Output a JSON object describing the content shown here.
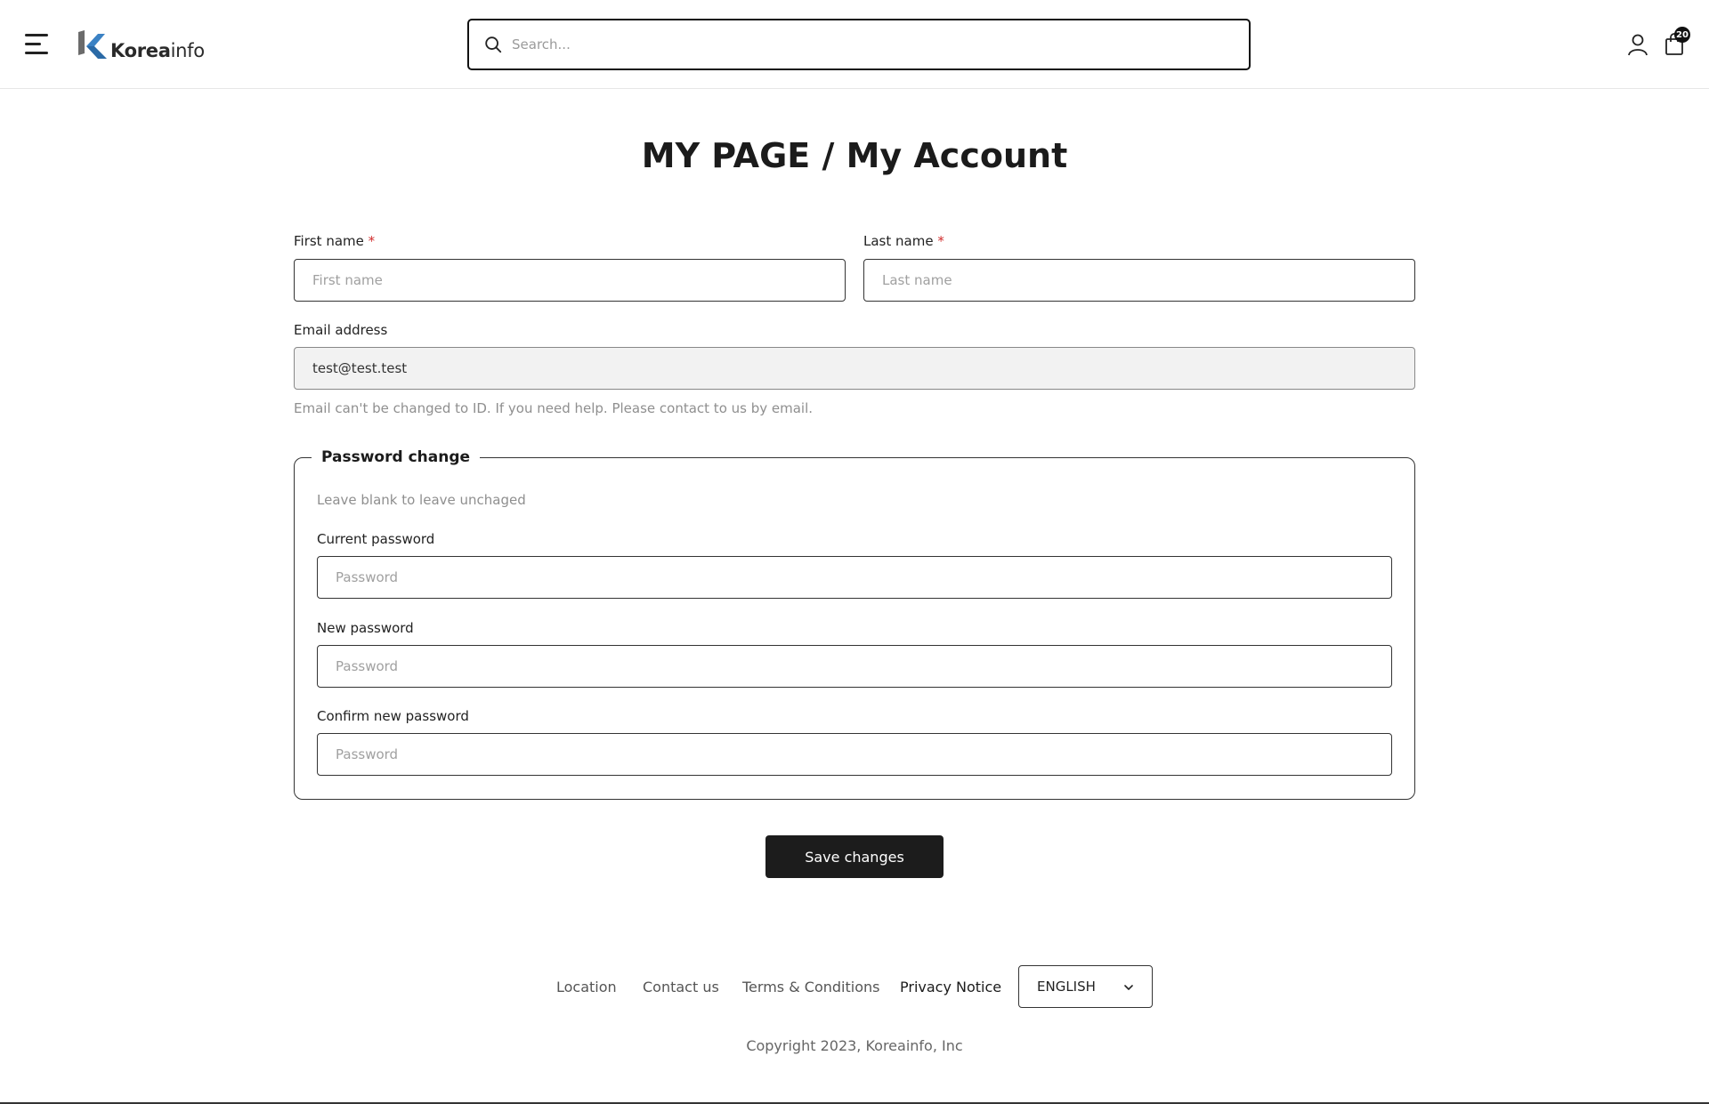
{
  "header": {
    "logo_text_bold": "Korea",
    "logo_text_light": "info",
    "search_placeholder": "Search...",
    "cart_count": "20"
  },
  "page": {
    "title_strong": "MY PAGE",
    "title_separator": " / ",
    "title_light": "My Account"
  },
  "form": {
    "first_name_label": "First name",
    "first_name_placeholder": "First name",
    "last_name_label": "Last name",
    "last_name_placeholder": "Last name",
    "required_mark": "*",
    "email_label": "Email address",
    "email_value": "test@test.test",
    "email_hint": "Email can't be changed to ID. If you need help. Please contact to us by email.",
    "password_section": {
      "legend": "Password change",
      "hint": "Leave blank to leave unchaged",
      "current_label": "Current password",
      "new_label": "New password",
      "confirm_label": "Confirm new password",
      "password_placeholder": "Password"
    },
    "save_label": "Save changes"
  },
  "footer": {
    "links": [
      "Location",
      "Contact us",
      "Terms & Conditions",
      "Privacy Notice"
    ],
    "language": "ENGLISH",
    "copyright": "Copyright 2023, Koreainfo, Inc"
  },
  "colors": {
    "primary_dark": "#1c1c1c",
    "required_red": "#d12c2c",
    "logo_blue": "#3b82c4",
    "logo_gray": "#6b6b6b"
  }
}
